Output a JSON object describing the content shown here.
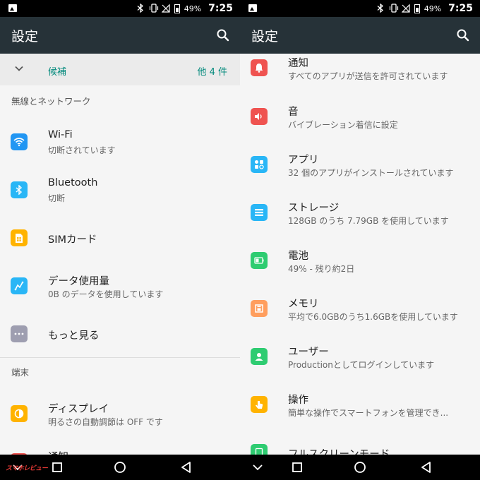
{
  "status": {
    "battery": "49%",
    "time": "7:25"
  },
  "left": {
    "title": "設定",
    "suggestions": {
      "label": "候補",
      "count": "他 4 件"
    },
    "sections": [
      {
        "header": "無線とネットワーク"
      },
      {
        "header": "端末"
      }
    ],
    "items": [
      {
        "title": "Wi-Fi",
        "subtitle": "切断されています",
        "icon": "wifi-icon",
        "color": "#2196f3"
      },
      {
        "title": "Bluetooth",
        "subtitle": "切断",
        "icon": "bluetooth-icon",
        "color": "#29b6f6"
      },
      {
        "title": "SIMカード",
        "subtitle": "",
        "icon": "sim-card-icon",
        "color": "#ffb300"
      },
      {
        "title": "データ使用量",
        "subtitle": "0B のデータを使用しています",
        "icon": "data-usage-icon",
        "color": "#29b6f6"
      },
      {
        "title": "もっと見る",
        "subtitle": "",
        "icon": "more-icon",
        "color": "#9e9eb0"
      },
      {
        "title": "ディスプレイ",
        "subtitle": "明るさの自動調節は OFF です",
        "icon": "display-icon",
        "color": "#ffb300"
      },
      {
        "title": "通知",
        "subtitle": "",
        "icon": "notification-icon",
        "color": "#ef5350"
      }
    ]
  },
  "right": {
    "title": "設定",
    "items": [
      {
        "title": "通知",
        "subtitle": "すべてのアプリが送信を許可されています",
        "icon": "notification-icon",
        "color": "#ef5350"
      },
      {
        "title": "音",
        "subtitle": "バイブレーション着信に設定",
        "icon": "sound-icon",
        "color": "#ef5350"
      },
      {
        "title": "アプリ",
        "subtitle": "32 個のアプリがインストールされています",
        "icon": "apps-icon",
        "color": "#29b6f6"
      },
      {
        "title": "ストレージ",
        "subtitle": "128GB のうち 7.79GB を使用しています",
        "icon": "storage-icon",
        "color": "#29b6f6"
      },
      {
        "title": "電池",
        "subtitle": "49% - 残り約2日",
        "icon": "battery-icon",
        "color": "#2ecc71"
      },
      {
        "title": "メモリ",
        "subtitle": "平均で6.0GBのうち1.6GBを使用しています",
        "icon": "memory-icon",
        "color": "#ff9e5e"
      },
      {
        "title": "ユーザー",
        "subtitle": "Productionとしてログインしています",
        "icon": "user-icon",
        "color": "#2ecc71"
      },
      {
        "title": "操作",
        "subtitle": "簡単な操作でスマートフォンを管理でき...",
        "icon": "gesture-icon",
        "color": "#ffb300"
      },
      {
        "title": "フルスクリーンモード",
        "subtitle": "",
        "icon": "fullscreen-icon",
        "color": "#2ecc71"
      }
    ]
  },
  "watermark": "スマホレビュー"
}
